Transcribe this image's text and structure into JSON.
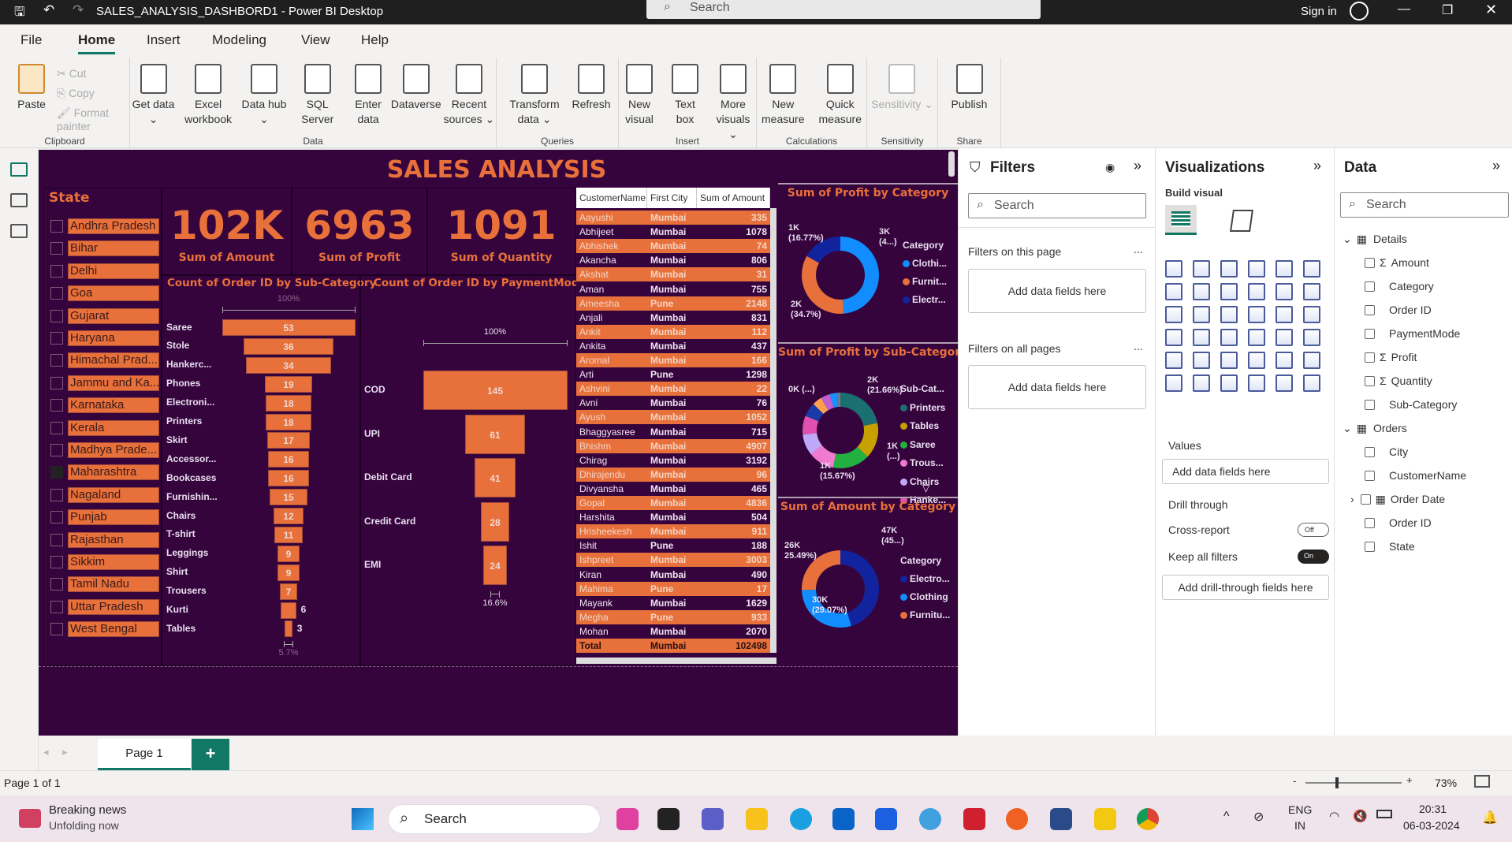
{
  "window": {
    "title": "SALES_ANALYSIS_DASHBORD1 - Power BI Desktop",
    "search_placeholder": "Search",
    "sign_in": "Sign in"
  },
  "menu": [
    "File",
    "Home",
    "Insert",
    "Modeling",
    "View",
    "Help"
  ],
  "ribbon": {
    "clipboard": {
      "label": "Clipboard",
      "paste": "Paste",
      "cut": "Cut",
      "copy": "Copy",
      "format_painter": "Format painter"
    },
    "groups": [
      {
        "label": "Data",
        "buttons": [
          "Get data ⌄",
          "Excel workbook",
          "Data hub ⌄",
          "SQL Server",
          "Enter data",
          "Dataverse",
          "Recent sources ⌄"
        ]
      },
      {
        "label": "Queries",
        "buttons": [
          "Transform data ⌄",
          "Refresh"
        ]
      },
      {
        "label": "Insert",
        "buttons": [
          "New visual",
          "Text box",
          "More visuals ⌄"
        ]
      },
      {
        "label": "Calculations",
        "buttons": [
          "New measure",
          "Quick measure"
        ]
      },
      {
        "label": "Sensitivity",
        "buttons": [
          "Sensitivity ⌄"
        ],
        "disabled": true
      },
      {
        "label": "Share",
        "buttons": [
          "Publish"
        ]
      }
    ]
  },
  "report": {
    "title": "SALES ANALYSIS",
    "accent": "#e8703a",
    "background": "#36043d",
    "slicer": {
      "title": "State",
      "selected": "Maharashtra",
      "items": [
        "Andhra Pradesh",
        "Bihar",
        "Delhi",
        "Goa",
        "Gujarat",
        "Haryana",
        "Himachal Prad...",
        "Jammu and Ka...",
        "Karnataka",
        "Kerala",
        "Madhya Prade...",
        "Maharashtra",
        "Nagaland",
        "Punjab",
        "Rajasthan",
        "Sikkim",
        "Tamil Nadu",
        "Uttar Pradesh",
        "West Bengal"
      ]
    },
    "kpis": [
      {
        "value": "102K",
        "label": "Sum of Amount"
      },
      {
        "value": "6963",
        "label": "Sum of Profit"
      },
      {
        "value": "1091",
        "label": "Sum of Quantity"
      }
    ],
    "table": {
      "headers": [
        "CustomerName",
        "First City",
        "Sum of Amount"
      ],
      "rows": [
        [
          "Aayushi",
          "Mumbai",
          "335"
        ],
        [
          "Abhijeet",
          "Mumbai",
          "1078"
        ],
        [
          "Abhishek",
          "Mumbai",
          "74"
        ],
        [
          "Akancha",
          "Mumbai",
          "806"
        ],
        [
          "Akshat",
          "Mumbai",
          "31"
        ],
        [
          "Aman",
          "Mumbai",
          "755"
        ],
        [
          "Ameesha",
          "Pune",
          "2148"
        ],
        [
          "Anjali",
          "Mumbai",
          "831"
        ],
        [
          "Ankit",
          "Mumbai",
          "112"
        ],
        [
          "Ankita",
          "Mumbai",
          "437"
        ],
        [
          "Aromal",
          "Mumbai",
          "166"
        ],
        [
          "Arti",
          "Pune",
          "1298"
        ],
        [
          "Ashvini",
          "Mumbai",
          "22"
        ],
        [
          "Avni",
          "Mumbai",
          "76"
        ],
        [
          "Ayush",
          "Mumbai",
          "1052"
        ],
        [
          "Bhaggyasree",
          "Mumbai",
          "715"
        ],
        [
          "Bhishm",
          "Mumbai",
          "4907"
        ],
        [
          "Chirag",
          "Mumbai",
          "3192"
        ],
        [
          "Dhirajendu",
          "Mumbai",
          "96"
        ],
        [
          "Divyansha",
          "Mumbai",
          "465"
        ],
        [
          "Gopal",
          "Mumbai",
          "4836"
        ],
        [
          "Harshita",
          "Mumbai",
          "504"
        ],
        [
          "Hrisheekesh",
          "Mumbai",
          "911"
        ],
        [
          "Ishit",
          "Pune",
          "188"
        ],
        [
          "Ishpreet",
          "Mumbai",
          "3003"
        ],
        [
          "Kiran",
          "Mumbai",
          "490"
        ],
        [
          "Mahima",
          "Pune",
          "17"
        ],
        [
          "Mayank",
          "Mumbai",
          "1629"
        ],
        [
          "Megha",
          "Pune",
          "933"
        ],
        [
          "Mohan",
          "Mumbai",
          "2070"
        ]
      ],
      "total": [
        "Total",
        "Mumbai",
        "102498"
      ]
    }
  },
  "chart_data": [
    {
      "type": "funnel",
      "title": "Count of Order ID by Sub-Category",
      "categories": [
        "Saree",
        "Stole",
        "Hankerc...",
        "Phones",
        "Electroni...",
        "Printers",
        "Skirt",
        "Accessor...",
        "Bookcases",
        "Furnishin...",
        "Chairs",
        "T-shirt",
        "Leggings",
        "Shirt",
        "Trousers",
        "Kurti",
        "Tables"
      ],
      "values": [
        53,
        36,
        34,
        19,
        18,
        18,
        17,
        16,
        16,
        15,
        12,
        11,
        9,
        9,
        7,
        6,
        3
      ],
      "top_label": "100%",
      "bottom_label": "5.7%"
    },
    {
      "type": "funnel",
      "title": "Count of Order ID by PaymentMode",
      "categories": [
        "COD",
        "UPI",
        "Debit Card",
        "Credit Card",
        "EMI"
      ],
      "values": [
        145,
        61,
        41,
        28,
        24
      ],
      "top_label": "100%",
      "bottom_label": "16.6%"
    },
    {
      "type": "pie",
      "title": "Sum of Profit by Category",
      "legend_title": "Category",
      "legend": [
        "Clothi...",
        "Furnit...",
        "Electr..."
      ],
      "values": [
        48.53,
        34.7,
        16.77
      ],
      "colors": [
        "#118dff",
        "#e8703a",
        "#12239e"
      ],
      "data_labels": [
        "3K\n(4...)",
        "2K\n(34.7%)",
        "1K\n(16.77%)"
      ],
      "legend_placement": "right"
    },
    {
      "type": "pie",
      "title": "Sum of Profit by Sub-Category",
      "legend_title": "Sub-Cat...",
      "legend": [
        "Printers",
        "Tables",
        "Saree",
        "Trous...",
        "Chairs",
        "Hanke..."
      ],
      "values": [
        21.66,
        15.2,
        15.67,
        11,
        9,
        8,
        6,
        4,
        4,
        3,
        1.5
      ],
      "colors": [
        "#1a7070",
        "#c8a000",
        "#22b040",
        "#f07ad0",
        "#c0a8f8",
        "#e050b0",
        "#1a3aa8",
        "#ffa050",
        "#c060d0",
        "#1a90ff",
        "#6a7a90"
      ],
      "data_labels": [
        "2K\n(21.66%)",
        "1K\n(...)",
        "1K\n(15.67%)",
        "0K (...)"
      ],
      "legend_placement": "right"
    },
    {
      "type": "pie",
      "title": "Sum of Amount by Category",
      "legend_title": "Category",
      "legend": [
        "Electro...",
        "Clothing",
        "Furnitu..."
      ],
      "values": [
        45.44,
        29.07,
        25.49
      ],
      "colors": [
        "#12239e",
        "#118dff",
        "#e8703a"
      ],
      "data_labels": [
        "47K\n(45...)",
        "30K\n(29.07%)",
        "26K\n25.49%)"
      ],
      "legend_placement": "right"
    }
  ],
  "filters": {
    "title": "Filters",
    "search": "Search",
    "on_page": "Filters on this page",
    "on_all": "Filters on all pages",
    "add": "Add data fields here",
    "more": "..."
  },
  "visualizations": {
    "title": "Visualizations",
    "build": "Build visual",
    "values": "Values",
    "add": "Add data fields here",
    "drill": "Drill through",
    "cross": "Cross-report",
    "cross_state": "Off",
    "keep": "Keep all filters",
    "keep_state": "On",
    "add_drill": "Add drill-through fields here"
  },
  "data_pane": {
    "title": "Data",
    "search": "Search",
    "tables": [
      {
        "name": "Details",
        "fields": [
          {
            "n": "Amount",
            "sum": true
          },
          {
            "n": "Category"
          },
          {
            "n": "Order ID"
          },
          {
            "n": "PaymentMode"
          },
          {
            "n": "Profit",
            "sum": true
          },
          {
            "n": "Quantity",
            "sum": true
          },
          {
            "n": "Sub-Category"
          }
        ]
      },
      {
        "name": "Orders",
        "fields": [
          {
            "n": "City"
          },
          {
            "n": "CustomerName"
          },
          {
            "n": "Order Date",
            "date": true
          },
          {
            "n": "Order ID"
          },
          {
            "n": "State"
          }
        ]
      }
    ]
  },
  "pages": {
    "tab": "Page 1",
    "add": "+"
  },
  "status": {
    "page": "Page 1 of 1",
    "zoom": "73%"
  },
  "taskbar": {
    "news_title": "Breaking news",
    "news_sub": "Unfolding now",
    "search": "Search",
    "lang": "ENG",
    "region": "IN",
    "time": "20:31",
    "date": "06-03-2024"
  }
}
